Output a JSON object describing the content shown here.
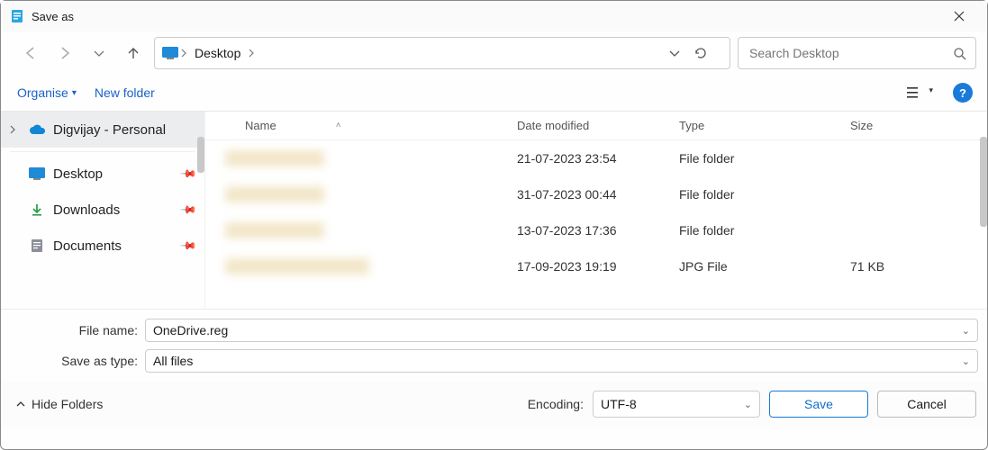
{
  "window": {
    "title": "Save as"
  },
  "nav": {
    "breadcrumb": "Desktop"
  },
  "search": {
    "placeholder": "Search Desktop"
  },
  "toolbar": {
    "organise": "Organise",
    "new_folder": "New folder"
  },
  "sidebar": {
    "onedrive": "Digvijay - Personal",
    "desktop": "Desktop",
    "downloads": "Downloads",
    "documents": "Documents"
  },
  "columns": {
    "name": "Name",
    "date": "Date modified",
    "type": "Type",
    "size": "Size"
  },
  "rows": [
    {
      "date": "21-07-2023 23:54",
      "type": "File folder",
      "size": ""
    },
    {
      "date": "31-07-2023 00:44",
      "type": "File folder",
      "size": ""
    },
    {
      "date": "13-07-2023 17:36",
      "type": "File folder",
      "size": ""
    },
    {
      "date": "17-09-2023 19:19",
      "type": "JPG File",
      "size": "71 KB"
    }
  ],
  "form": {
    "filename_label": "File name:",
    "filename_value": "OneDrive.reg",
    "saveastype_label": "Save as type:",
    "saveastype_value": "All files"
  },
  "bottom": {
    "hide_folders": "Hide Folders",
    "encoding_label": "Encoding:",
    "encoding_value": "UTF-8",
    "save": "Save",
    "cancel": "Cancel"
  }
}
